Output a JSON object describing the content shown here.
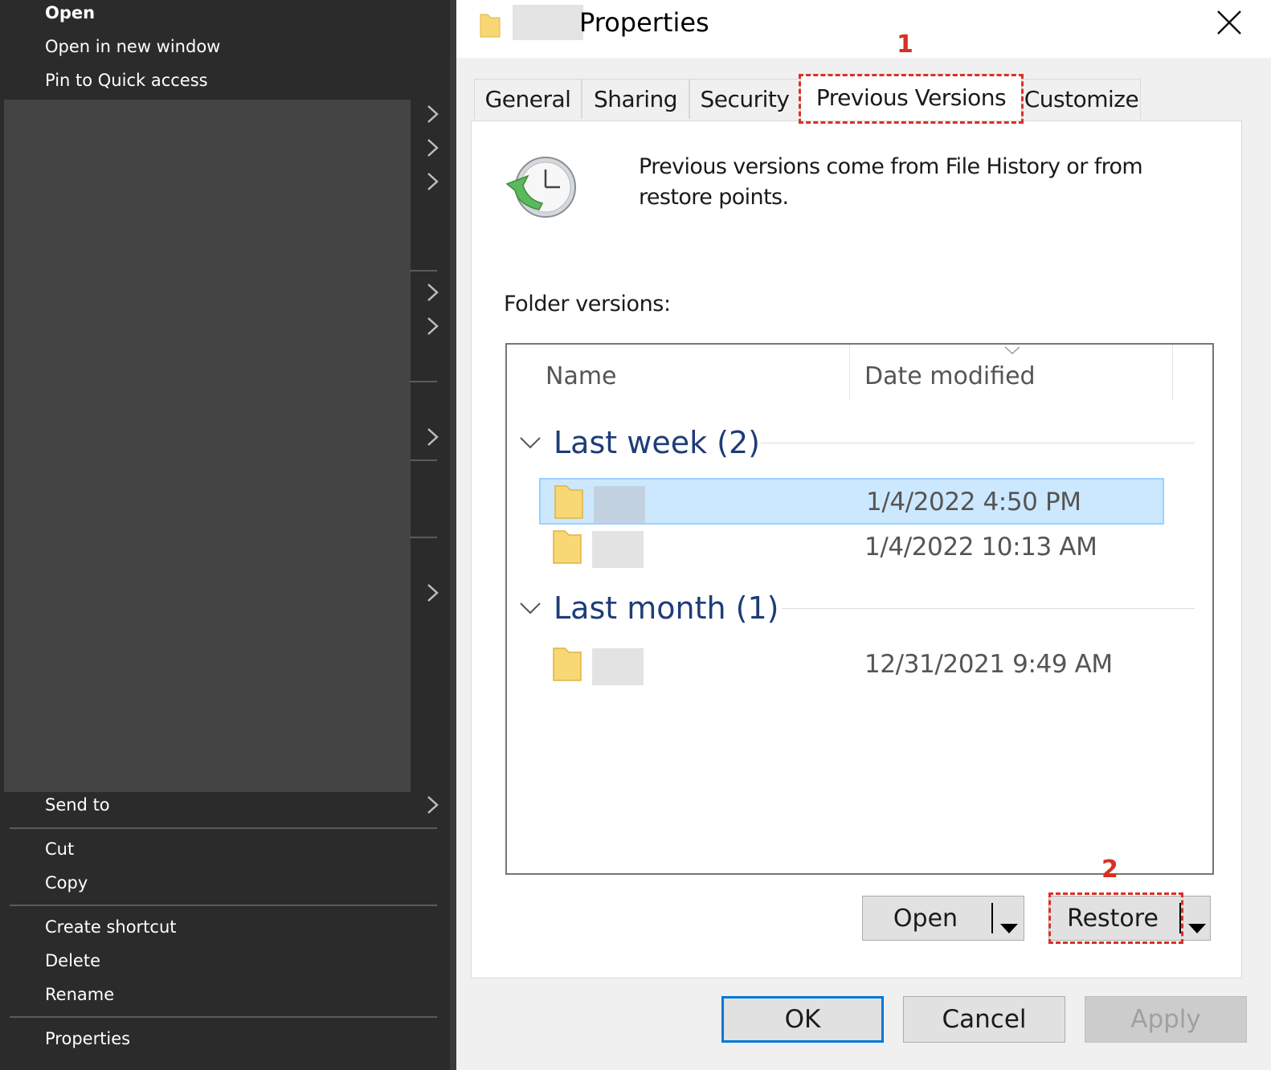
{
  "context_menu": {
    "items_top": [
      "Open",
      "Open in new window",
      "Pin to Quick access"
    ],
    "send_to": "Send to",
    "edit_items": [
      "Cut",
      "Copy"
    ],
    "manage_items": [
      "Create shortcut",
      "Delete",
      "Rename"
    ],
    "properties": "Properties"
  },
  "dialog": {
    "title": "Properties",
    "tabs": [
      "General",
      "Sharing",
      "Security",
      "Previous Versions",
      "Customize"
    ],
    "active_tab": "Previous Versions",
    "description": "Previous versions come from File History or from restore points.",
    "folder_versions_label": "Folder versions:",
    "columns": {
      "name": "Name",
      "date_modified": "Date modified"
    },
    "groups": [
      {
        "label": "Last week (2)",
        "rows": [
          {
            "date": "1/4/2022 4:50 PM",
            "selected": true
          },
          {
            "date": "1/4/2022 10:13 AM",
            "selected": false
          }
        ]
      },
      {
        "label": "Last month (1)",
        "rows": [
          {
            "date": "12/31/2021 9:49 AM",
            "selected": false
          }
        ]
      }
    ],
    "open_button": "Open",
    "restore_button": "Restore",
    "ok_button": "OK",
    "cancel_button": "Cancel",
    "apply_button": "Apply"
  },
  "annotations": {
    "step1": "1",
    "step2": "2",
    "color": "#d93025"
  },
  "icons": [
    "folder-icon",
    "close-icon",
    "previous-versions-clock-icon",
    "chevron-right-icon",
    "chevron-down-icon",
    "dropdown-arrow-icon"
  ]
}
